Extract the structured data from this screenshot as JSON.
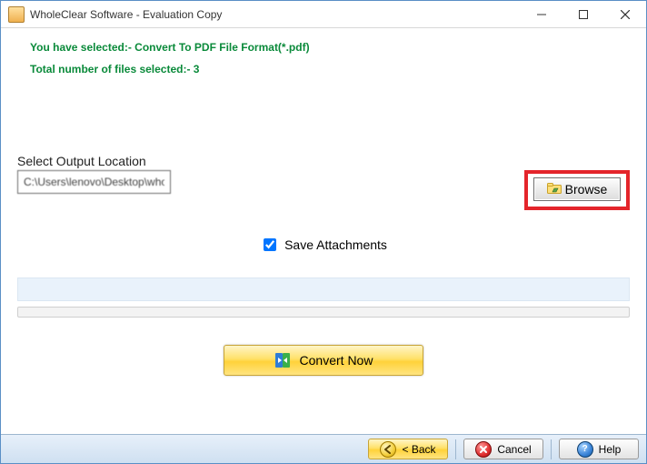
{
  "window": {
    "title": "WholeClear Software - Evaluation Copy"
  },
  "info": {
    "selected_format": "You have selected:- Convert To PDF File Format(*.pdf)",
    "file_count": "Total number of files selected:- 3"
  },
  "output": {
    "label": "Select Output Location",
    "path": "C:\\Users\\lenovo\\Desktop\\whole-clear\\New folder\\New folder\\pdf",
    "browse_label": "Browse"
  },
  "options": {
    "save_attachments_label": "Save Attachments",
    "save_attachments_checked": true
  },
  "actions": {
    "convert_label": "Convert Now"
  },
  "footer": {
    "back_label": "< Back",
    "cancel_label": "Cancel",
    "help_label": "Help"
  }
}
